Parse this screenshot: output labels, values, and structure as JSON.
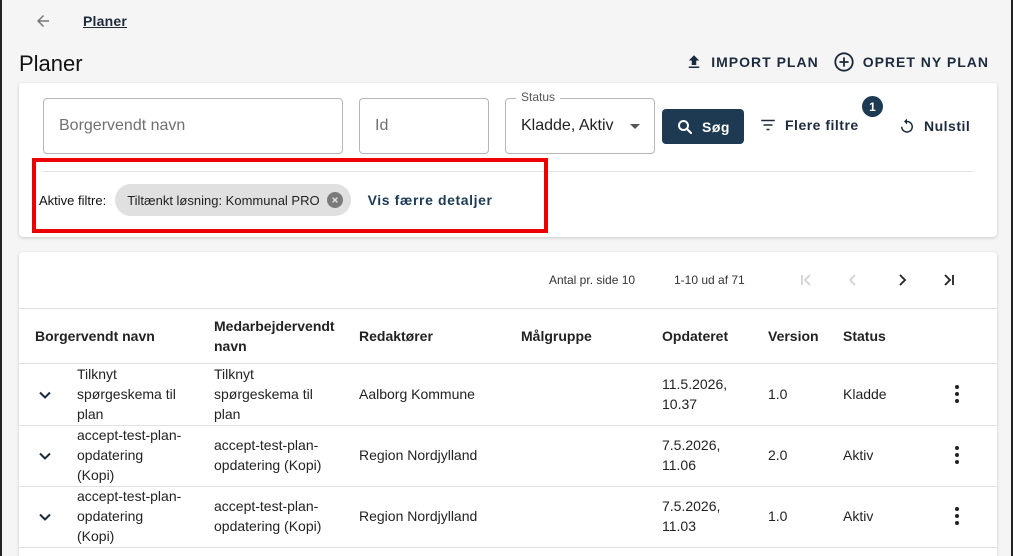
{
  "nav": {
    "breadcrumb": "Planer"
  },
  "page": {
    "title": "Planer"
  },
  "actions": {
    "import_label": "IMPORT PLAN",
    "create_label": "OPRET NY PLAN"
  },
  "filters": {
    "name_placeholder": "Borgervendt navn",
    "id_placeholder": "Id",
    "status_label": "Status",
    "status_value": "Kladde, Aktiv",
    "search_label": "Søg",
    "more_filters_label": "Flere filtre",
    "more_filters_count": "1",
    "reset_label": "Nulstil",
    "active_label": "Aktive filtre:",
    "active_chips": [
      "Tiltænkt løsning: Kommunal PRO"
    ],
    "show_less_label": "Vis færre detaljer"
  },
  "pagination": {
    "per_page_label": "Antal pr. side 10",
    "range_label": "1-10 ud af 71"
  },
  "table": {
    "columns": [
      "Borgervendt navn",
      "Medarbejdervendt navn",
      "Redaktører",
      "Målgruppe",
      "Opdateret",
      "Version",
      "Status"
    ],
    "rows": [
      {
        "citizen_name": [
          "Tilknyt",
          "spørgeskema til",
          "plan"
        ],
        "employee_name": [
          "Tilknyt",
          "spørgeskema til",
          "plan"
        ],
        "editors": "Aalborg Kommune",
        "target_group": "",
        "updated": [
          "11.5.2026,",
          "10.37"
        ],
        "version": "1.0",
        "status": "Kladde"
      },
      {
        "citizen_name": [
          "accept-test-plan-",
          "opdatering",
          "(Kopi)"
        ],
        "employee_name": [
          "accept-test-plan-",
          "opdatering (Kopi)"
        ],
        "editors": "Region Nordjylland",
        "target_group": "",
        "updated": [
          "7.5.2026,",
          "11.06"
        ],
        "version": "2.0",
        "status": "Aktiv"
      },
      {
        "citizen_name": [
          "accept-test-plan-",
          "opdatering",
          "(Kopi)"
        ],
        "employee_name": [
          "accept-test-plan-",
          "opdatering (Kopi)"
        ],
        "editors": "Region Nordjylland",
        "target_group": "",
        "updated": [
          "7.5.2026,",
          "11.03"
        ],
        "version": "1.0",
        "status": "Aktiv"
      }
    ]
  },
  "colors": {
    "primary": "#1d3a52",
    "highlight_border": "#ee0000",
    "chip_bg": "#e0e0e0"
  },
  "icons": {
    "back": "arrow-left-icon",
    "import": "upload-icon",
    "create": "plus-circle-icon",
    "search": "search-icon",
    "more_filters": "filter-lines-icon",
    "reset": "refresh-icon",
    "chip_remove": "close-circle-icon",
    "expand": "chevron-down-icon",
    "row_menu": "kebab-menu-icon",
    "first_page": "first-page-icon",
    "prev_page": "chevron-left-icon",
    "next_page": "chevron-right-icon",
    "last_page": "last-page-icon"
  }
}
